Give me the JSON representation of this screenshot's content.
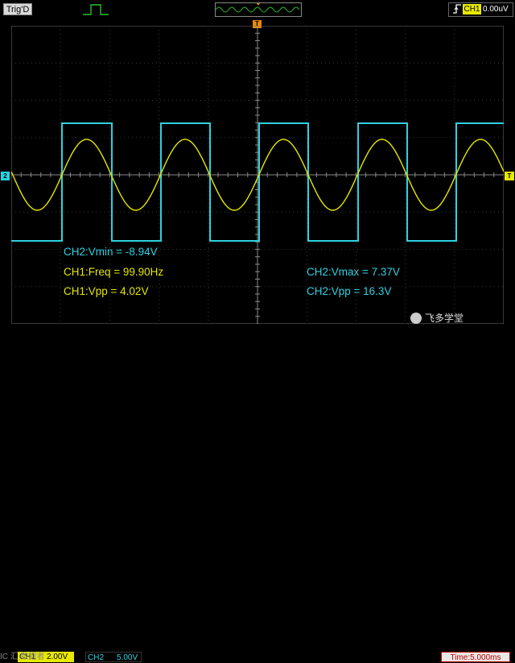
{
  "status": {
    "trigger_state": "Trig'D",
    "trigger_source": "CH1",
    "trigger_level": "0.00uV"
  },
  "markers": {
    "ch2_ground": "2",
    "trigger_level": "T",
    "trigger_position": "T"
  },
  "measurements": [
    {
      "text": "CH2:Vmin = -8.94V",
      "color": "#2ed1e0"
    },
    {
      "text": "CH1:Freq = 99.90Hz",
      "color": "#e6e600"
    },
    {
      "text": "CH1:Vpp = 4.02V",
      "color": "#e6e600"
    },
    {
      "text": "CH2:Vmax = 7.37V",
      "color": "#2ed1e0"
    },
    {
      "text": "CH2:Vpp = 16.3V",
      "color": "#2ed1e0"
    }
  ],
  "bottom": {
    "ch1_label": "CH1",
    "ch1_scale": "2.00V",
    "ch2_label": "CH2",
    "ch2_scale": "5.00V",
    "time_scale": "Time:5.000ms",
    "watermark": "IC 汇 数据者",
    "brand": "飞多学堂"
  },
  "colors": {
    "ch1": "#e6e600",
    "ch2": "#2ed1e0",
    "grid": "#6f6f6f",
    "background": "#000000"
  }
}
